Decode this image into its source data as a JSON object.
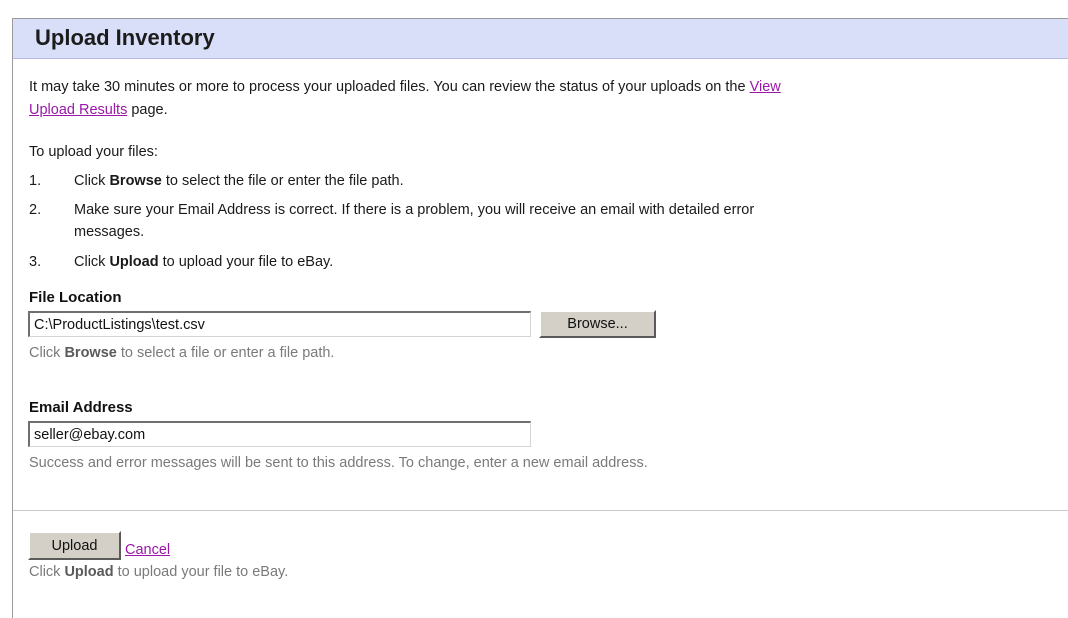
{
  "page": {
    "title": "Upload Inventory"
  },
  "intro": {
    "line1_text": "It may take 30 minutes or more to process your uploaded files. You can review the status of your uploads on the ",
    "link_part1": "View",
    "link_part2": "Upload Results",
    "line2_suffix": " page."
  },
  "instructions": {
    "heading": "To upload your files:",
    "steps": [
      {
        "num": "1.",
        "before": "Click ",
        "bold": "Browse",
        "after": " to select the file or enter the file path."
      },
      {
        "num": "2.",
        "line1": "Make sure your Email Address is correct. If there is a problem, you will receive an email with detailed error",
        "line2": "messages."
      },
      {
        "num": "3.",
        "before": "Click ",
        "bold": "Upload",
        "after": " to upload your file to eBay."
      }
    ]
  },
  "file_location": {
    "label": "File Location",
    "value": "C:\\ProductListings\\test.csv",
    "browse_label": "Browse...",
    "help_before": "Click ",
    "help_bold": "Browse",
    "help_after": " to select a file or enter a file path."
  },
  "email": {
    "label": "Email Address",
    "value": "seller@ebay.com",
    "help": "Success and error messages will be sent to this address. To change, enter a new email address."
  },
  "actions": {
    "upload_label": "Upload",
    "cancel_label": "Cancel",
    "help_before": "Click ",
    "help_bold": "Upload",
    "help_after": " to upload your file to eBay."
  },
  "colors": {
    "title_bar": "#d9def9",
    "link": "#9b17a8",
    "button_face": "#d4d0c8",
    "help_text": "#7a7a7a"
  }
}
